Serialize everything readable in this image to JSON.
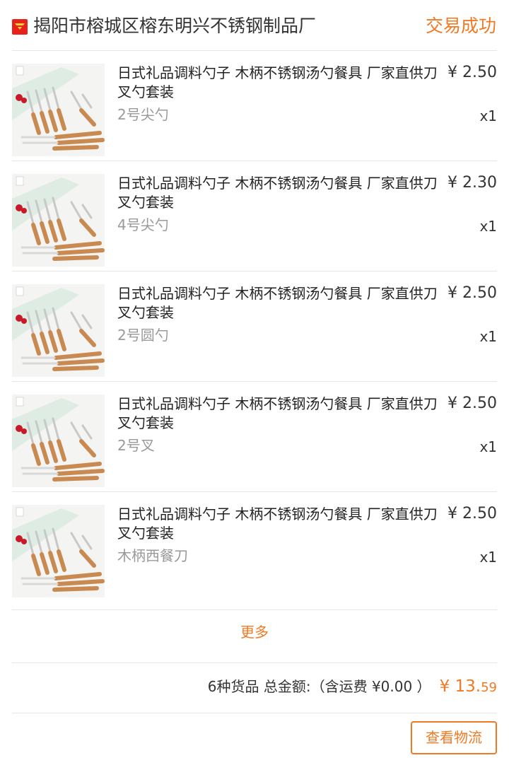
{
  "shop": {
    "name": "揭阳市榕城区榕东明兴不锈钢制品厂",
    "icon": "shop-icon"
  },
  "order": {
    "status": "交易成功"
  },
  "items": [
    {
      "title": "日式礼品调料勺子 木柄不锈钢汤勺餐具 厂家直供刀叉勺套装",
      "sku": "2号尖勺",
      "price": "¥ 2.50",
      "qty": "x1"
    },
    {
      "title": "日式礼品调料勺子 木柄不锈钢汤勺餐具 厂家直供刀叉勺套装",
      "sku": "4号尖勺",
      "price": "¥ 2.30",
      "qty": "x1"
    },
    {
      "title": "日式礼品调料勺子 木柄不锈钢汤勺餐具 厂家直供刀叉勺套装",
      "sku": "2号圆勺",
      "price": "¥ 2.50",
      "qty": "x1"
    },
    {
      "title": "日式礼品调料勺子 木柄不锈钢汤勺餐具 厂家直供刀叉勺套装",
      "sku": "2号叉",
      "price": "¥ 2.50",
      "qty": "x1"
    },
    {
      "title": "日式礼品调料勺子 木柄不锈钢汤勺餐具 厂家直供刀叉勺套装",
      "sku": "木柄西餐刀",
      "price": "¥ 2.50",
      "qty": "x1"
    }
  ],
  "more_label": "更多",
  "summary": {
    "text": "6种货品 总金额:（含运费 ¥0.00 ）",
    "total_main": "¥ 13.",
    "total_cents": "59"
  },
  "actions": {
    "logistics_label": "查看物流"
  },
  "colors": {
    "accent": "#f07a23",
    "shop_icon": "#e8211a"
  }
}
